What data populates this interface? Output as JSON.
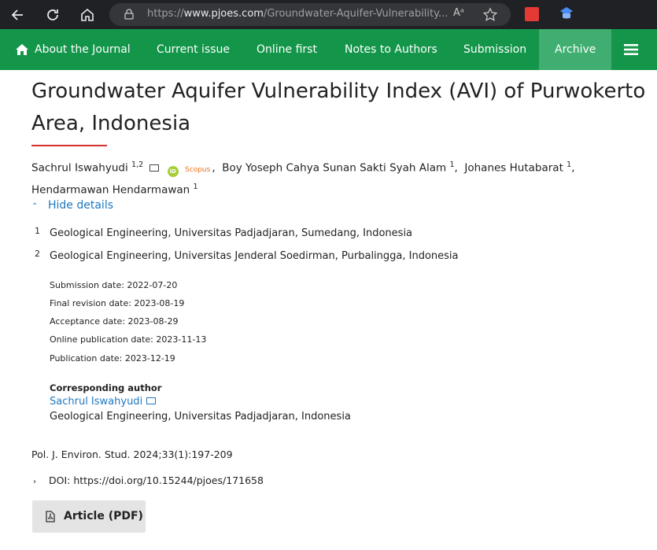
{
  "browser": {
    "url_prefix": "https://",
    "url_domain": "www.pjoes.com",
    "url_rest": "/Groundwater-Aquifer-Vulnerability...",
    "read_aloud": "Aᵃ"
  },
  "nav": {
    "items": [
      "About the Journal",
      "Current issue",
      "Online first",
      "Notes to Authors",
      "Submission",
      "Archive"
    ],
    "active": "Archive",
    "colors": {
      "bar": "#14964a",
      "active": "#3fae70"
    }
  },
  "article": {
    "title_line1": "Groundwater Aquifer Vulnerability Index (AVI) of Purwokerto",
    "title_line2": "Area, Indonesia",
    "authors": [
      {
        "name": "Sachrul Iswahyudi",
        "sup": "1,2"
      },
      {
        "name": "Boy Yoseph Cahya Sunan Sakti Syah Alam",
        "sup": "1"
      },
      {
        "name": "Johanes Hutabarat",
        "sup": "1"
      },
      {
        "name": "Hendarmawan Hendarmawan",
        "sup": "1"
      }
    ],
    "orcid_badge": "iD",
    "scopus_label": "Scopus",
    "hide_details": "Hide details",
    "affiliations": [
      {
        "num": "1",
        "text": "Geological Engineering, Universitas Padjadjaran, Sumedang, Indonesia"
      },
      {
        "num": "2",
        "text": "Geological Engineering, Universitas Jenderal Soedirman, Purbalingga, Indonesia"
      }
    ],
    "dates": [
      "Submission date: 2022-07-20",
      "Final revision date: 2023-08-19",
      "Acceptance date: 2023-08-29",
      "Online publication date: 2023-11-13",
      "Publication date: 2023-12-19"
    ],
    "corresponding": {
      "heading": "Corresponding author",
      "name": "Sachrul Iswahyudi",
      "affiliation": "Geological Engineering, Universitas Padjadjaran, Indonesia"
    },
    "citation": "Pol. J. Environ. Stud. 2024;33(1):197-209",
    "doi": "DOI: https://doi.org/10.15244/pjoes/171658",
    "pdf_button": "Article (PDF)"
  }
}
